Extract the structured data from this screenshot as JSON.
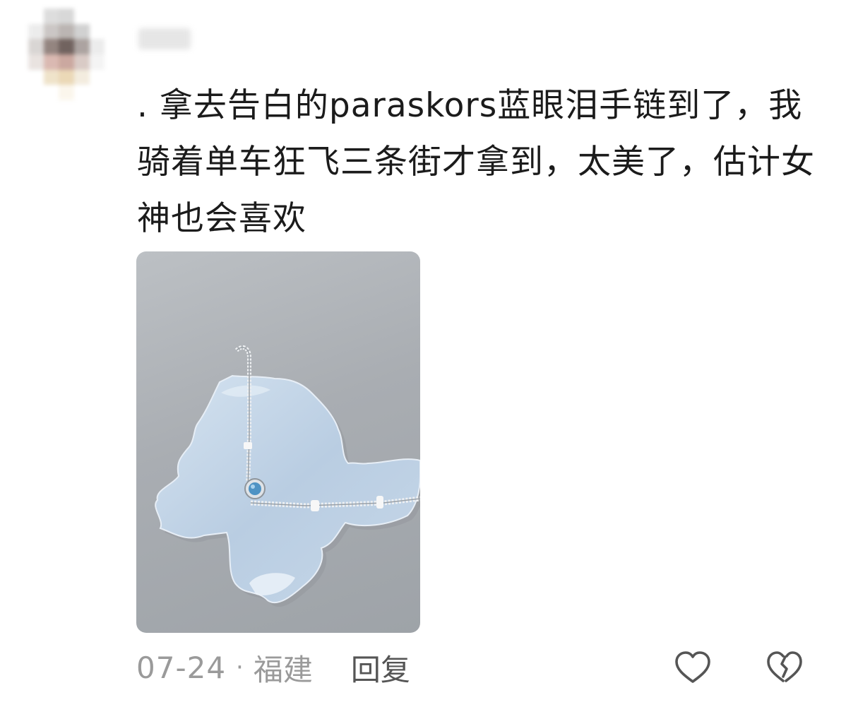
{
  "comment": {
    "text": ". 拿去告白的paraskors蓝眼泪手链到了，我骑着单车狂飞三条街才拿到，太美了，估计女神也会喜欢",
    "date": "07-24",
    "separator": "·",
    "location": "福建",
    "reply_label": "回复"
  },
  "icons": {
    "like": "heart-outline-icon",
    "dislike": "broken-heart-outline-icon"
  },
  "colors": {
    "text": "#1b1b1b",
    "meta": "#9a9a9a",
    "reply": "#555555",
    "icon": "#555555"
  }
}
